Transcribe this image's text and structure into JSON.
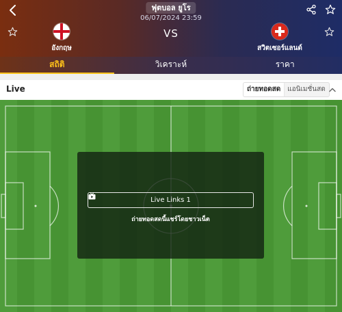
{
  "header": {
    "league": "ฟุตบอล ยูโร",
    "datetime": "06/07/2024 23:59",
    "vs": "VS",
    "home_team": {
      "name": "อังกฤษ",
      "flag": "england-flag-icon"
    },
    "away_team": {
      "name": "สวิตเซอร์แลนด์",
      "flag": "switzerland-flag-icon"
    }
  },
  "tabs": [
    {
      "label": "สถิติ",
      "active": true
    },
    {
      "label": "วิเคราะห์",
      "active": false
    },
    {
      "label": "ราคา",
      "active": false
    }
  ],
  "live": {
    "title": "Live",
    "modes": [
      {
        "label": "ถ่ายทอดสด",
        "active": true
      },
      {
        "label": "แอนิเมชั่นสด",
        "active": false
      }
    ],
    "links_label": "Live Links 1",
    "stream_note": "ถ่ายทอดสดนี้แชร์โดยชาวเน็ต"
  },
  "colors": {
    "accent": "#ffc21a",
    "pitch_light": "#4f9c3b",
    "pitch_dark": "#479333",
    "header_left": "#7a2e10",
    "header_right": "#1e2c66"
  }
}
